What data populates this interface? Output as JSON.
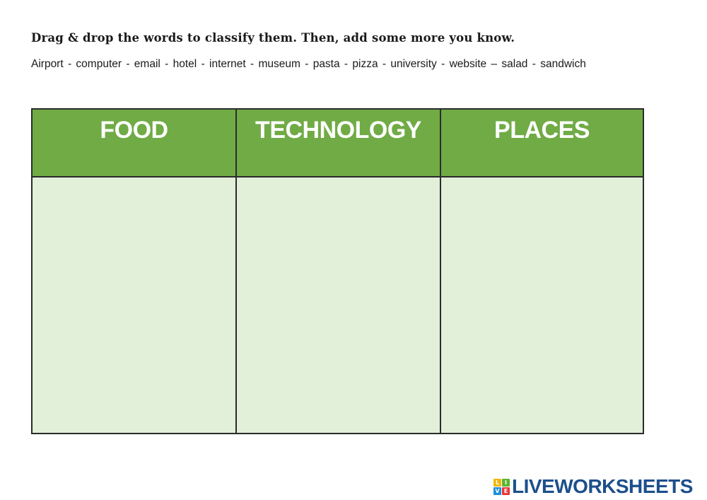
{
  "instruction": "Drag & drop the words to classify them. Then, add some more you know.",
  "word_bank": "Airport  -  computer   - email   - hotel  -   internet  - museum  -  pasta  -   pizza  -    university   -  website – salad - sandwich",
  "table": {
    "columns": [
      {
        "header": "FOOD",
        "items": []
      },
      {
        "header": "TECHNOLOGY",
        "items": []
      },
      {
        "header": "PLACES",
        "items": []
      }
    ],
    "header_color": "#70ab45",
    "cell_color": "#e2efd9"
  },
  "logo": {
    "blocks": [
      {
        "letter": "L",
        "color": "#f2b705"
      },
      {
        "letter": "I",
        "color": "#5cb531"
      },
      {
        "letter": "V",
        "color": "#1f8fd6"
      },
      {
        "letter": "E",
        "color": "#e8363c"
      }
    ],
    "text": "LIVEWORKSHEETS"
  }
}
